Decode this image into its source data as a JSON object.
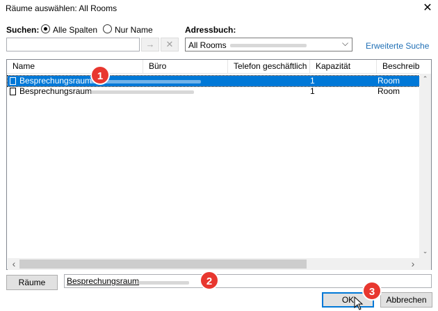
{
  "window": {
    "title": "Räume auswählen: All Rooms",
    "close_icon": "close-icon"
  },
  "search": {
    "label": "Suchen:",
    "option_all": "Alle Spalten",
    "option_name": "Nur Name",
    "selected": "Alle Spalten",
    "value": "",
    "go_icon": "→",
    "clear_icon": "✕"
  },
  "addressbook": {
    "label": "Adressbuch:",
    "value": "All Rooms",
    "chevron": "⌵"
  },
  "advanced_search": "Erweiterte Suche",
  "table": {
    "columns": [
      "Name",
      "Büro",
      "Telefon geschäftlich",
      "Kapazität",
      "Beschreibung"
    ],
    "rows": [
      {
        "name": "Besprechungsraum",
        "capacity": "1",
        "description": "Room",
        "selected": true
      },
      {
        "name": "Besprechungsraum",
        "capacity": "1",
        "description": "Room",
        "selected": false
      }
    ]
  },
  "scroll": {
    "up": "⌃",
    "down": "⌄",
    "left": "‹",
    "right": "›"
  },
  "rooms_button": "Räume",
  "rooms_field_value": "Besprechungsraum",
  "ok_button": "OK",
  "cancel_button": "Abbrechen",
  "callouts": [
    "1",
    "2",
    "3"
  ],
  "colors": {
    "selection": "#0078d7",
    "link": "#1f6fb5",
    "callout": "#e8372f"
  }
}
